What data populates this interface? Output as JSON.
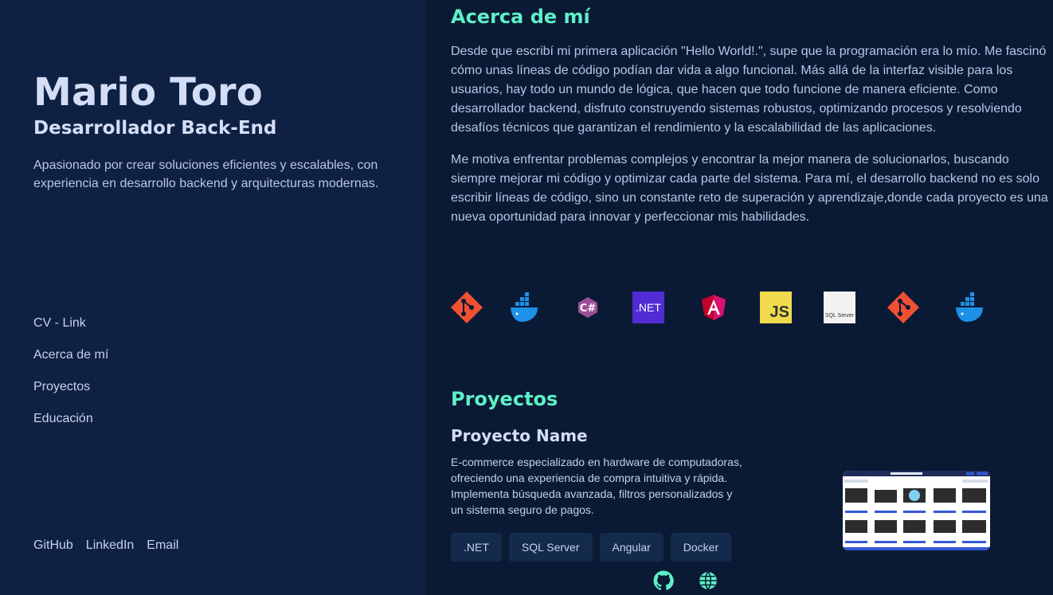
{
  "profile": {
    "name": "Mario Toro",
    "role": "Desarrollador Back-End",
    "intro": "Apasionado por crear soluciones eficientes y escalables, con experiencia en desarrollo backend y arquitecturas modernas."
  },
  "nav": {
    "items": [
      {
        "label": "CV - Link"
      },
      {
        "label": "Acerca de mí"
      },
      {
        "label": "Proyectos"
      },
      {
        "label": "Educación"
      }
    ]
  },
  "social": {
    "github": "GitHub",
    "linkedin": "LinkedIn",
    "email": "Email"
  },
  "about": {
    "title": "Acerca de mí",
    "p1": "Desde que escribí mi primera aplicación \"Hello World!.\", supe que la programación era lo mío. Me fascinó cómo unas líneas de código podían dar vida a algo funcional. Más allá de la interfaz visible para los usuarios, hay todo un mundo de lógica, que hacen que todo funcione de manera eficiente. Como desarrollador backend, disfruto construyendo sistemas robustos, optimizando procesos y resolviendo desafíos técnicos que garantizan el rendimiento y la escalabilidad de las aplicaciones.",
    "p2": "Me motiva enfrentar problemas complejos y encontrar la mejor manera de solucionarlos, buscando siempre mejorar mi código y optimizar cada parte del sistema. Para mí, el desarrollo backend no es solo escribir líneas de código, sino un constante reto de superación y aprendizaje,donde cada proyecto es una nueva oportunidad para innovar y perfeccionar mis habilidades."
  },
  "tech_icons": {
    "items": [
      "git-icon",
      "docker-icon",
      "csharp-icon",
      "dotnet-icon",
      "angular-icon",
      "javascript-icon",
      "sqlserver-icon",
      "git-icon",
      "docker-icon"
    ],
    "dotnet_text": ".NET",
    "js_text": "JS",
    "sql_text": "SQL Server"
  },
  "projects": {
    "title": "Proyectos",
    "items": [
      {
        "name": "Proyecto Name",
        "description": "E-commerce especializado en hardware de computadoras, ofreciendo una experiencia de compra intuitiva y rápida. Implementa búsqueda avanzada, filtros personalizados y un sistema seguro de pagos.",
        "tags": [
          ".NET",
          "SQL Server",
          "Angular",
          "Docker"
        ],
        "links": [
          "github-icon",
          "globe-icon"
        ]
      }
    ]
  },
  "colors": {
    "accent": "#5ef0c8",
    "sidebar_bg": "#0f2143",
    "main_bg": "#0b1a34"
  }
}
